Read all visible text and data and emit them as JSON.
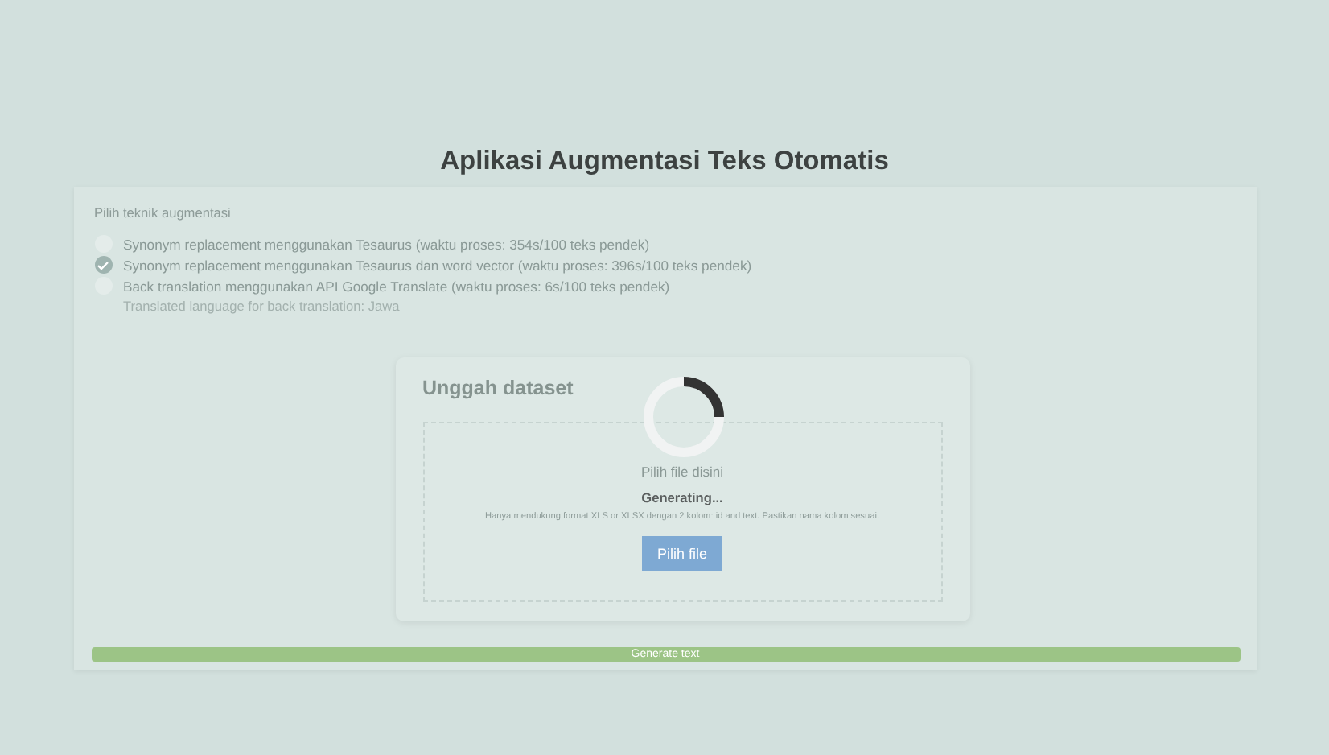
{
  "title": "Aplikasi Augmentasi Teks Otomatis",
  "technique": {
    "label": "Pilih teknik augmentasi",
    "options": [
      {
        "label": "Synonym replacement menggunakan Tesaurus (waktu proses: 354s/100 teks pendek)",
        "selected": false
      },
      {
        "label": "Synonym replacement menggunakan Tesaurus dan word vector (waktu proses: 396s/100 teks pendek)",
        "selected": true
      },
      {
        "label": "Back translation menggunakan API Google Translate (waktu proses: 6s/100 teks pendek)",
        "selected": false
      }
    ],
    "note": "Translated language for back translation: Jawa"
  },
  "upload": {
    "title": "Unggah dataset",
    "prompt": "Pilih file disini",
    "status": "Generating...",
    "hint": "Hanya mendukung format XLS or XLSX dengan 2 kolom: id and text. Pastikan nama kolom sesuai.",
    "button": "Pilih file"
  },
  "generate_button": "Generate text"
}
